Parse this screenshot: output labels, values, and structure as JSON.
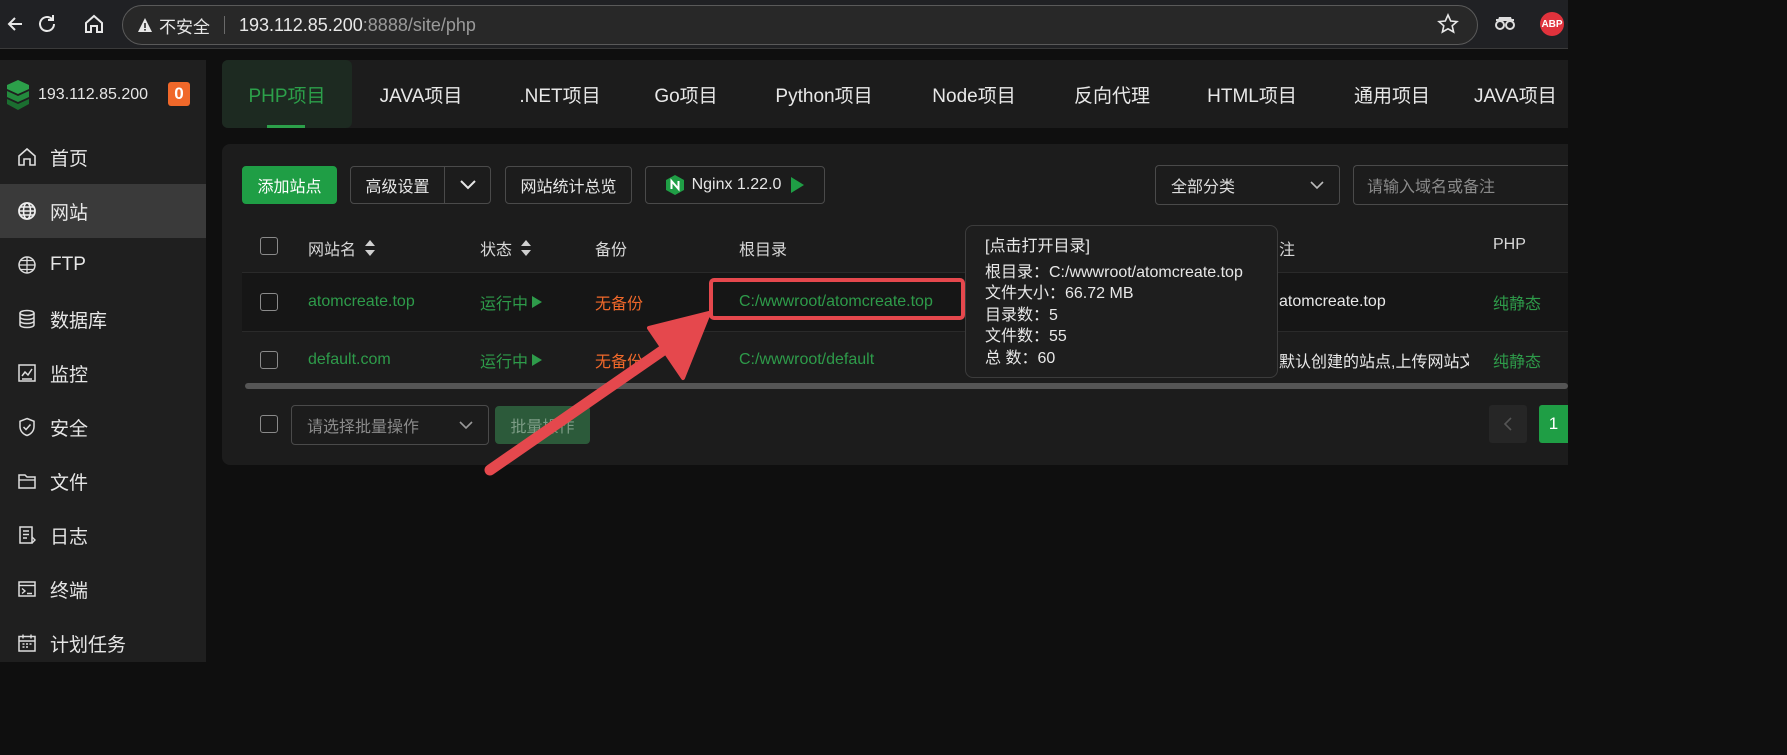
{
  "browser": {
    "insecure_label": "不安全",
    "url_host": "193.112.85.200",
    "url_rest": ":8888/site/php",
    "ext_abp": "ABP"
  },
  "sidebar": {
    "server_ip": "193.112.85.200",
    "badge": "0",
    "items": [
      {
        "label": "首页",
        "icon": "home-icon"
      },
      {
        "label": "网站",
        "icon": "globe-icon",
        "active": true
      },
      {
        "label": "FTP",
        "icon": "ftp-icon"
      },
      {
        "label": "数据库",
        "icon": "database-icon"
      },
      {
        "label": "监控",
        "icon": "monitor-icon"
      },
      {
        "label": "安全",
        "icon": "shield-icon"
      },
      {
        "label": "文件",
        "icon": "folder-icon"
      },
      {
        "label": "日志",
        "icon": "log-icon"
      },
      {
        "label": "终端",
        "icon": "terminal-icon"
      },
      {
        "label": "计划任务",
        "icon": "calendar-icon"
      }
    ]
  },
  "tabs": [
    "PHP项目",
    "JAVA项目",
    ".NET项目",
    "Go项目",
    "Python项目",
    "Node项目",
    "反向代理",
    "HTML项目",
    "通用项目",
    "JAVA项目"
  ],
  "toolbar": {
    "add_site": "添加站点",
    "advanced": "高级设置",
    "stats": "网站统计总览",
    "nginx": "Nginx 1.22.0",
    "category": "全部分类",
    "search_placeholder": "请输入域名或备注"
  },
  "table": {
    "headers": {
      "name": "网站名",
      "status": "状态",
      "backup": "备份",
      "root": "根目录",
      "note": "注",
      "php": "PHP"
    },
    "rows": [
      {
        "name": "atomcreate.top",
        "status": "运行中",
        "backup": "无备份",
        "root": "C:/wwwroot/atomcreate.top",
        "note": "atomcreate.top",
        "php": "纯静态"
      },
      {
        "name": "default.com",
        "status": "运行中",
        "backup": "无备份",
        "root": "C:/wwwroot/default",
        "note": "默认创建的站点,上传网站文",
        "php": "纯静态"
      }
    ]
  },
  "footer": {
    "batch_placeholder": "请选择批量操作",
    "batch_button": "批量操作",
    "page": "1"
  },
  "tooltip": {
    "title": "[点击打开目录]",
    "lines": [
      "根目录：C:/wwwroot/atomcreate.top",
      "文件大小：66.72 MB",
      "目录数：5",
      "文件数：55",
      "总 数：60"
    ]
  },
  "colors": {
    "accent": "#1f9e45",
    "warning": "#f0682a",
    "annotation": "#e5484d"
  }
}
